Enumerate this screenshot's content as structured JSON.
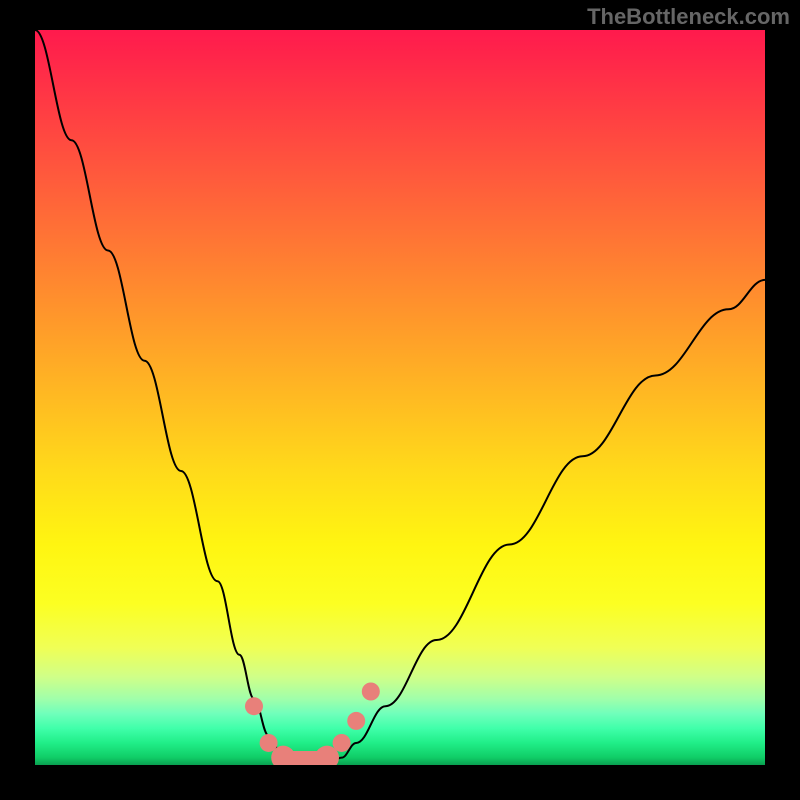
{
  "watermark": "TheBottleneck.com",
  "chart_data": {
    "type": "line",
    "title": "",
    "xlabel": "",
    "ylabel": "",
    "xlim": [
      0,
      100
    ],
    "ylim": [
      0,
      100
    ],
    "series": [
      {
        "name": "bottleneck-curve",
        "x": [
          0,
          5,
          10,
          15,
          20,
          25,
          28,
          30,
          32,
          34,
          36,
          38,
          40,
          42,
          44,
          48,
          55,
          65,
          75,
          85,
          95,
          100
        ],
        "y": [
          100,
          85,
          70,
          55,
          40,
          25,
          15,
          9,
          4,
          1,
          0,
          0,
          0,
          1,
          3,
          8,
          17,
          30,
          42,
          53,
          62,
          66
        ]
      }
    ],
    "markers": {
      "name": "highlighted-points",
      "x": [
        30,
        32,
        34,
        36,
        38,
        40,
        42,
        44,
        46
      ],
      "y": [
        8,
        3,
        1,
        0,
        0,
        1,
        3,
        6,
        10
      ]
    },
    "gradient_stops": [
      {
        "pct": 0,
        "color": "#ff1a4d"
      },
      {
        "pct": 50,
        "color": "#ffda1a"
      },
      {
        "pct": 80,
        "color": "#fcff22"
      },
      {
        "pct": 95,
        "color": "#40ffaa"
      },
      {
        "pct": 100,
        "color": "#0aa050"
      }
    ]
  }
}
